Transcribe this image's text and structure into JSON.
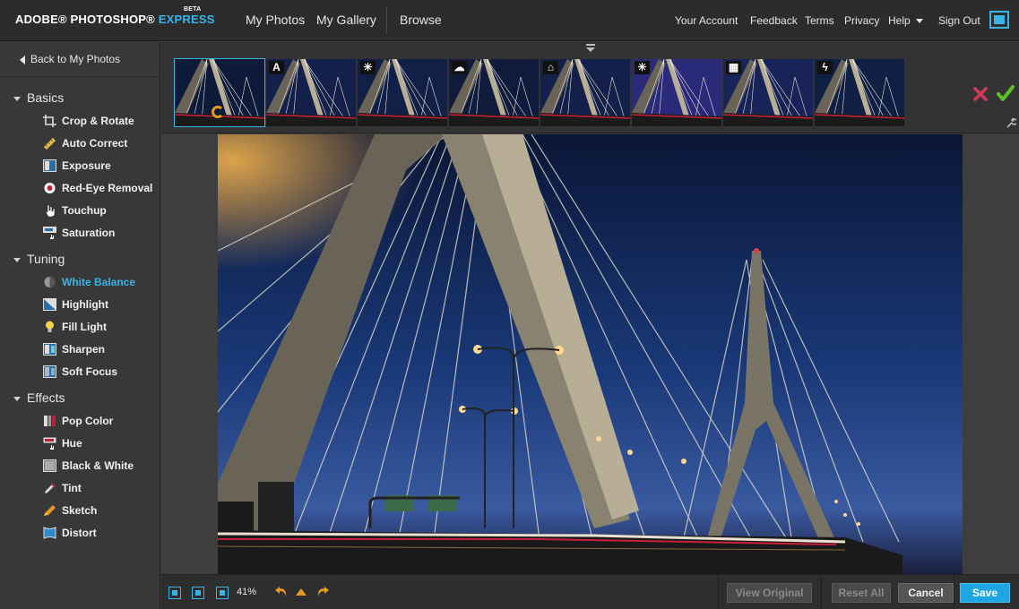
{
  "header": {
    "logo_adobe": "ADOBE® PHOTOSHOP®",
    "logo_express": "EXPRESS",
    "logo_beta": "BETA",
    "nav": [
      "My Photos",
      "My Gallery",
      "Browse"
    ],
    "right_nav": [
      "Your Account",
      "Feedback",
      "Terms",
      "Privacy",
      "Help",
      "Sign Out"
    ],
    "icon": "fullscreen-icon"
  },
  "sidebar": {
    "back_label": "Back to My Photos",
    "sections": [
      {
        "title": "Basics",
        "tools": [
          {
            "label": "Crop & Rotate",
            "icon": "crop-icon"
          },
          {
            "label": "Auto Correct",
            "icon": "auto-correct-icon"
          },
          {
            "label": "Exposure",
            "icon": "exposure-icon"
          },
          {
            "label": "Red-Eye Removal",
            "icon": "red-eye-icon"
          },
          {
            "label": "Touchup",
            "icon": "touchup-hand-icon"
          },
          {
            "label": "Saturation",
            "icon": "saturation-icon"
          }
        ]
      },
      {
        "title": "Tuning",
        "tools": [
          {
            "label": "White Balance",
            "icon": "white-balance-icon",
            "active": true
          },
          {
            "label": "Highlight",
            "icon": "highlight-icon"
          },
          {
            "label": "Fill Light",
            "icon": "fill-light-bulb-icon"
          },
          {
            "label": "Sharpen",
            "icon": "sharpen-icon"
          },
          {
            "label": "Soft Focus",
            "icon": "soft-focus-icon"
          }
        ]
      },
      {
        "title": "Effects",
        "tools": [
          {
            "label": "Pop Color",
            "icon": "pop-color-icon"
          },
          {
            "label": "Hue",
            "icon": "hue-icon"
          },
          {
            "label": "Black & White",
            "icon": "black-white-icon"
          },
          {
            "label": "Tint",
            "icon": "tint-dropper-icon"
          },
          {
            "label": "Sketch",
            "icon": "sketch-pencil-icon"
          },
          {
            "label": "Distort",
            "icon": "distort-icon"
          }
        ]
      }
    ]
  },
  "filmstrip": {
    "thumbnails": [
      {
        "badge": "",
        "icon": "revert-icon",
        "selected": true
      },
      {
        "badge": "A",
        "icon": "auto-icon"
      },
      {
        "badge": "☀",
        "icon": "sun-icon"
      },
      {
        "badge": "☁",
        "icon": "cloud-icon"
      },
      {
        "badge": "⌂",
        "icon": "shade-house-icon"
      },
      {
        "badge": "☀",
        "icon": "bright-sun-icon"
      },
      {
        "badge": "▦",
        "icon": "fluorescent-icon"
      },
      {
        "badge": "ϟ",
        "icon": "flash-icon"
      }
    ],
    "reject_icon": "reject-x-icon",
    "accept_icon": "accept-check-icon"
  },
  "bottombar": {
    "zoom": "41%",
    "view_original": "View Original",
    "reset_all": "Reset All",
    "cancel": "Cancel",
    "save": "Save"
  },
  "colors": {
    "accent": "#3ab4e8",
    "save_button": "#1ea6e4",
    "undo_orange": "#e39a1f"
  }
}
